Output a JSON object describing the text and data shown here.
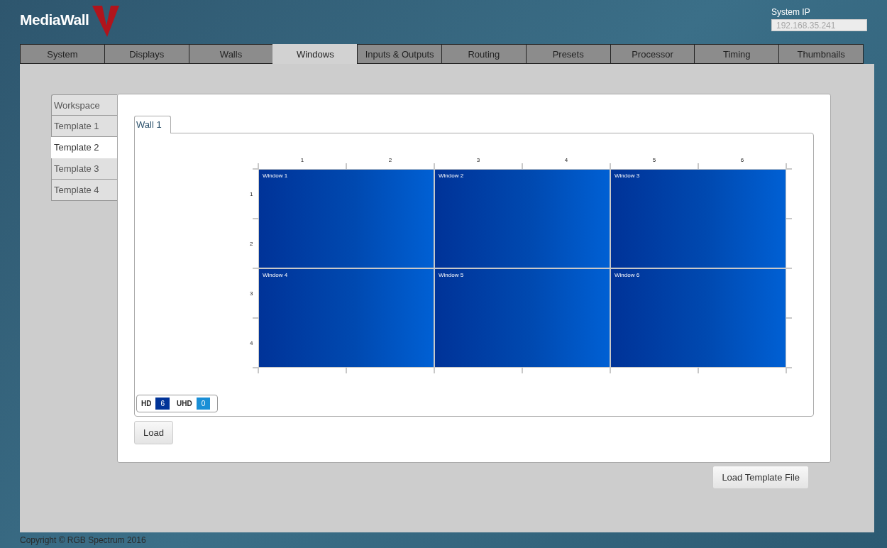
{
  "logo": {
    "text": "MediaWall"
  },
  "system_ip": {
    "label": "System IP",
    "value": "192.168.35.241"
  },
  "tabs": [
    {
      "label": "System",
      "selected": false
    },
    {
      "label": "Displays",
      "selected": false
    },
    {
      "label": "Walls",
      "selected": false
    },
    {
      "label": "Windows",
      "selected": true
    },
    {
      "label": "Inputs & Outputs",
      "selected": false
    },
    {
      "label": "Routing",
      "selected": false
    },
    {
      "label": "Presets",
      "selected": false
    },
    {
      "label": "Processor",
      "selected": false
    },
    {
      "label": "Timing",
      "selected": false
    },
    {
      "label": "Thumbnails",
      "selected": false
    }
  ],
  "side_tabs": [
    {
      "label": "Workspace",
      "selected": false
    },
    {
      "label": "Template 1",
      "selected": false
    },
    {
      "label": "Template 2",
      "selected": true
    },
    {
      "label": "Template 3",
      "selected": false
    },
    {
      "label": "Template 4",
      "selected": false
    }
  ],
  "wall_tabs": [
    {
      "label": "Wall 1",
      "selected": true
    }
  ],
  "wall": {
    "columns": [
      "1",
      "2",
      "3",
      "4",
      "5",
      "6"
    ],
    "rows": [
      "1",
      "2",
      "3",
      "4"
    ],
    "windows": [
      {
        "label": "Window 1",
        "kind": "hd"
      },
      {
        "label": "Window 2",
        "kind": "hd"
      },
      {
        "label": "Window 3",
        "kind": "hd"
      },
      {
        "label": "Window 4",
        "kind": "hd"
      },
      {
        "label": "Window 5",
        "kind": "hd"
      },
      {
        "label": "Window 6",
        "kind": "hd"
      }
    ]
  },
  "legend": [
    {
      "label": "HD",
      "count": "6",
      "kind": "hd"
    },
    {
      "label": "UHD",
      "count": "0",
      "kind": "uhd"
    }
  ],
  "load_button": "Load",
  "load_template_button": "Load Template File",
  "footer": "Copyright © RGB Spectrum 2016"
}
